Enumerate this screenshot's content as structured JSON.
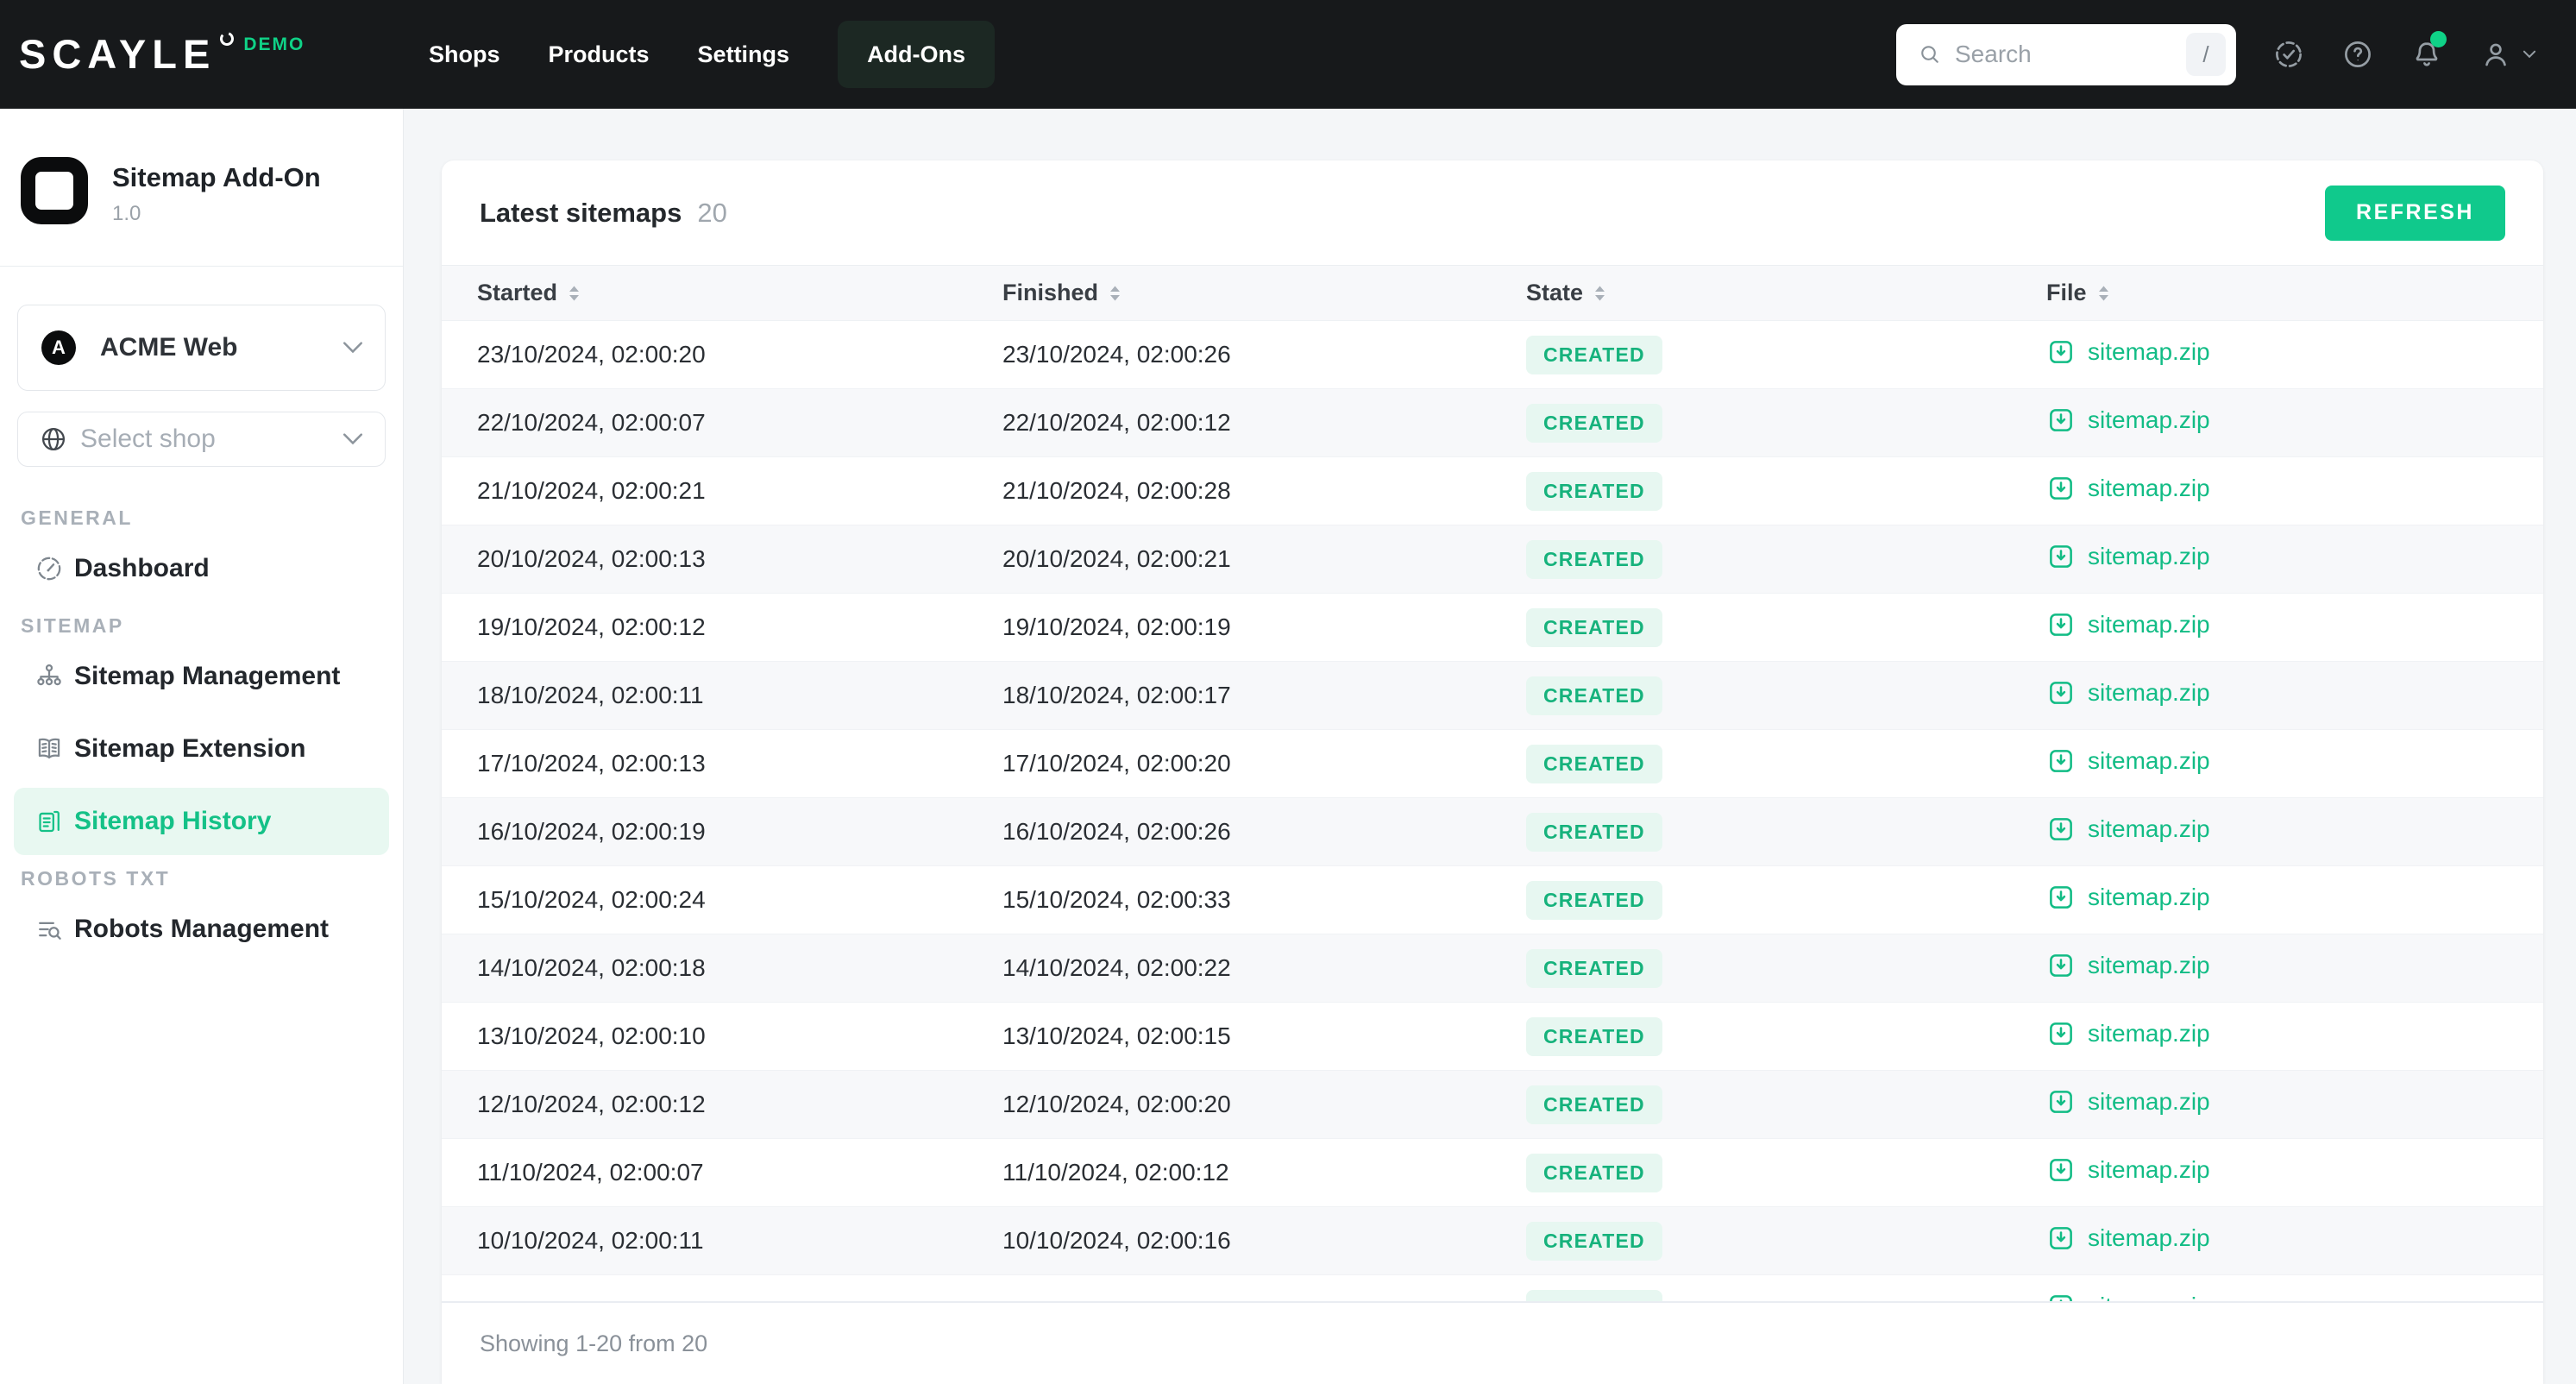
{
  "topbar": {
    "logo": "SCAYLE",
    "demo_label": "DEMO",
    "nav": [
      {
        "label": "Shops",
        "active": false
      },
      {
        "label": "Products",
        "active": false
      },
      {
        "label": "Settings",
        "active": false
      },
      {
        "label": "Add-Ons",
        "active": true
      }
    ],
    "search": {
      "placeholder": "Search",
      "shortcut_key": "/"
    }
  },
  "sidebar": {
    "app": {
      "name": "Sitemap Add-On",
      "version": "1.0"
    },
    "tenant": {
      "name": "ACME Web",
      "initial": "A"
    },
    "shop_selector": {
      "placeholder": "Select shop"
    },
    "sections": [
      {
        "label": "GENERAL",
        "items": [
          {
            "label": "Dashboard",
            "icon": "dashboard-icon",
            "active": false
          }
        ]
      },
      {
        "label": "SITEMAP",
        "items": [
          {
            "label": "Sitemap Management",
            "icon": "sitemap-management-icon",
            "active": false
          },
          {
            "label": "Sitemap Extension",
            "icon": "sitemap-extension-icon",
            "active": false
          },
          {
            "label": "Sitemap History",
            "icon": "sitemap-history-icon",
            "active": true
          }
        ]
      },
      {
        "label": "ROBOTS TXT",
        "items": [
          {
            "label": "Robots Management",
            "icon": "robots-management-icon",
            "active": false
          }
        ]
      }
    ]
  },
  "main": {
    "title": "Latest sitemaps",
    "count": "20",
    "refresh_label": "REFRESH",
    "columns": [
      "Started",
      "Finished",
      "State",
      "File"
    ],
    "rows": [
      {
        "started": "23/10/2024, 02:00:20",
        "finished": "23/10/2024, 02:00:26",
        "state": "CREATED",
        "file": "sitemap.zip"
      },
      {
        "started": "22/10/2024, 02:00:07",
        "finished": "22/10/2024, 02:00:12",
        "state": "CREATED",
        "file": "sitemap.zip"
      },
      {
        "started": "21/10/2024, 02:00:21",
        "finished": "21/10/2024, 02:00:28",
        "state": "CREATED",
        "file": "sitemap.zip"
      },
      {
        "started": "20/10/2024, 02:00:13",
        "finished": "20/10/2024, 02:00:21",
        "state": "CREATED",
        "file": "sitemap.zip"
      },
      {
        "started": "19/10/2024, 02:00:12",
        "finished": "19/10/2024, 02:00:19",
        "state": "CREATED",
        "file": "sitemap.zip"
      },
      {
        "started": "18/10/2024, 02:00:11",
        "finished": "18/10/2024, 02:00:17",
        "state": "CREATED",
        "file": "sitemap.zip"
      },
      {
        "started": "17/10/2024, 02:00:13",
        "finished": "17/10/2024, 02:00:20",
        "state": "CREATED",
        "file": "sitemap.zip"
      },
      {
        "started": "16/10/2024, 02:00:19",
        "finished": "16/10/2024, 02:00:26",
        "state": "CREATED",
        "file": "sitemap.zip"
      },
      {
        "started": "15/10/2024, 02:00:24",
        "finished": "15/10/2024, 02:00:33",
        "state": "CREATED",
        "file": "sitemap.zip"
      },
      {
        "started": "14/10/2024, 02:00:18",
        "finished": "14/10/2024, 02:00:22",
        "state": "CREATED",
        "file": "sitemap.zip"
      },
      {
        "started": "13/10/2024, 02:00:10",
        "finished": "13/10/2024, 02:00:15",
        "state": "CREATED",
        "file": "sitemap.zip"
      },
      {
        "started": "12/10/2024, 02:00:12",
        "finished": "12/10/2024, 02:00:20",
        "state": "CREATED",
        "file": "sitemap.zip"
      },
      {
        "started": "11/10/2024, 02:00:07",
        "finished": "11/10/2024, 02:00:12",
        "state": "CREATED",
        "file": "sitemap.zip"
      },
      {
        "started": "10/10/2024, 02:00:11",
        "finished": "10/10/2024, 02:00:16",
        "state": "CREATED",
        "file": "sitemap.zip"
      }
    ],
    "partial_row": {
      "started": "",
      "finished": "",
      "state": "CREATED",
      "file": "sitemap.zip"
    },
    "footer_text": "Showing 1-20 from 20"
  },
  "colors": {
    "accent_green": "#10C98C",
    "badge_bg": "#E7F7F1",
    "badge_text": "#16B27C",
    "active_item_bg": "#E8F8F1",
    "link_green": "#12BC85",
    "notification_dot": "#0FD287",
    "topbar_bg": "#17191B",
    "page_bg": "#F4F6F8"
  }
}
